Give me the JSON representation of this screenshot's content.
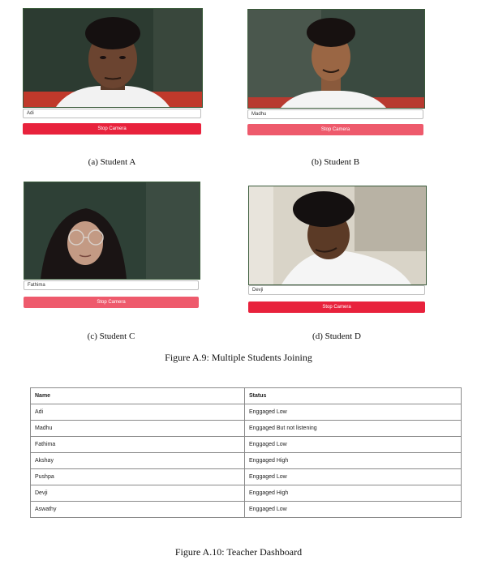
{
  "students": [
    {
      "id": "a",
      "name": "Adi",
      "button": "Stop Camera",
      "caption": "(a) Student A"
    },
    {
      "id": "b",
      "name": "Madhu",
      "button": "Stop Camera",
      "caption": "(b) Student B"
    },
    {
      "id": "c",
      "name": "Fathima",
      "button": "Stop Camera",
      "caption": "(c) Student C"
    },
    {
      "id": "d",
      "name": "Devji",
      "button": "Stop Camera",
      "caption": "(d) Student D"
    }
  ],
  "figure_a9": "Figure A.9: Multiple Students Joining",
  "dashboard": {
    "headers": [
      "Name",
      "Status"
    ],
    "rows": [
      [
        "Adi",
        "Enggaged Low"
      ],
      [
        "Madhu",
        "Enggaged But not listening"
      ],
      [
        "Fathima",
        "Enggaged Low"
      ],
      [
        "Akshay",
        "Enggaged High"
      ],
      [
        "Pushpa",
        "Enggaged Low"
      ],
      [
        "Devji",
        "Enggaged High"
      ],
      [
        "Aswathy",
        "Enggaged Low"
      ]
    ]
  },
  "figure_a10": "Figure A.10: Teacher Dashboard",
  "colors": {
    "button_red": "#e8223c",
    "board_green": "#2c3f33"
  }
}
